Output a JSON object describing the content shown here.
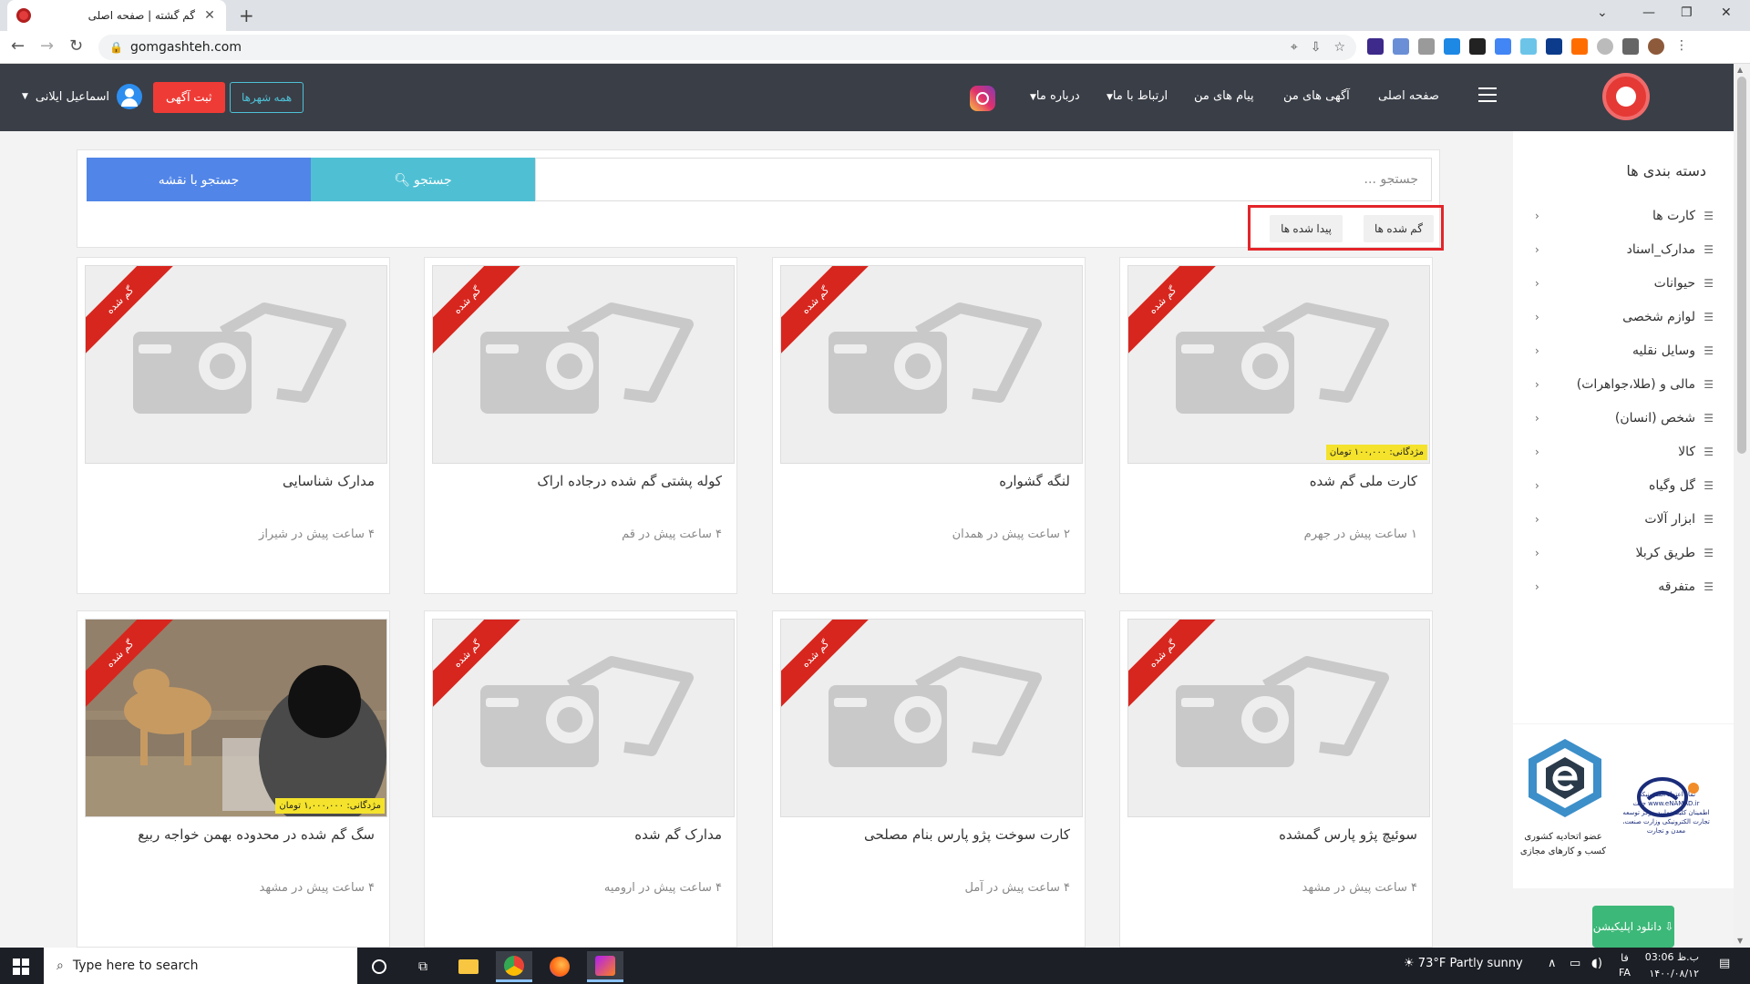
{
  "browser": {
    "tab_title": "گم گشته | صفحه اصلی",
    "new_tab": "+",
    "url": "gomgashteh.com"
  },
  "header": {
    "user_name": "اسماعیل ایلانی",
    "post_ad": "ثبت آگهی",
    "all_cities": "همه شهرها",
    "nav": {
      "home": "صفحه اصلی",
      "my_ads": "آگهی های من",
      "my_messages": "پیام های من",
      "contact": "ارتباط با ما",
      "about": "درباره ما"
    }
  },
  "search": {
    "placeholder": "جستجو ...",
    "search_button": "جستجو",
    "map_button": "جستجو با نقشه",
    "filter_lost": "گم شده ها",
    "filter_found": "پیدا شده ها"
  },
  "sidebar": {
    "title": "دسته بندی ها",
    "categories": [
      "کارت ها",
      "مدارک_اسناد",
      "حیوانات",
      "لوازم شخصی",
      "وسایل نقلیه",
      "مالی و (طلا،جواهرات)",
      "شخص (انسان)",
      "کالا",
      "گل وگیاه",
      "ابزار آلات",
      "طریق کربلا",
      "متفرقه"
    ]
  },
  "ribbon_label": "گم شده",
  "cards": [
    {
      "title": "کارت ملی گم شده",
      "meta": "۱ ساعت پیش در جهرم",
      "reward": "مژدگانی: ۱۰۰,۰۰۰ تومان"
    },
    {
      "title": "لنگه گشواره",
      "meta": "۲ ساعت پیش در همدان",
      "reward": ""
    },
    {
      "title": "کوله پشتی گم شده درجاده اراک",
      "meta": "۴ ساعت پیش در قم",
      "reward": ""
    },
    {
      "title": "مدارک شناسایی",
      "meta": "۴ ساعت پیش در شیراز",
      "reward": ""
    },
    {
      "title": "سوئیچ پژو پارس گمشده",
      "meta": "۴ ساعت پیش در مشهد",
      "reward": ""
    },
    {
      "title": "کارت سوخت پژو پارس بنام مصلحی",
      "meta": "۴ ساعت پیش در آمل",
      "reward": ""
    },
    {
      "title": "مدارک گم شده",
      "meta": "۴ ساعت پیش در ارومیه",
      "reward": ""
    },
    {
      "title": "سگ گم شده در محدوده بهمن خواجه ربیع",
      "meta": "۴ ساعت پیش در مشهد",
      "reward": "مژدگانی: ۱,۰۰۰,۰۰۰ تومان"
    }
  ],
  "badges": {
    "union_line1": "عضو اتحادیه کشوری",
    "union_line2": "کسب و کارهای مجازی",
    "enamad_text": "نماد اعتماد الکترونیکی www.eNAMAD.ir جهت اطمینان کلیک نمایید مرکز توسعه تجارت الکترونیکی وزارت صنعت، معدن و تجارت"
  },
  "download": {
    "label": "دانلود اپلیکیشن"
  },
  "taskbar": {
    "search_placeholder": "Type here to search",
    "weather": "73°F  Partly sunny",
    "lang": "فا",
    "lang2": "FA",
    "time": "ب.ظ 03:06",
    "date": "۱۴۰۰/۰۸/۱۲"
  },
  "colors": {
    "header_bg": "#3a3e47",
    "ribbon": "#d7261e",
    "search_button": "#4fc0d4",
    "map_button": "#5185e8",
    "reward": "#f4e22c",
    "post_ad": "#ef3b36",
    "highlight_box": "#e3252a"
  }
}
